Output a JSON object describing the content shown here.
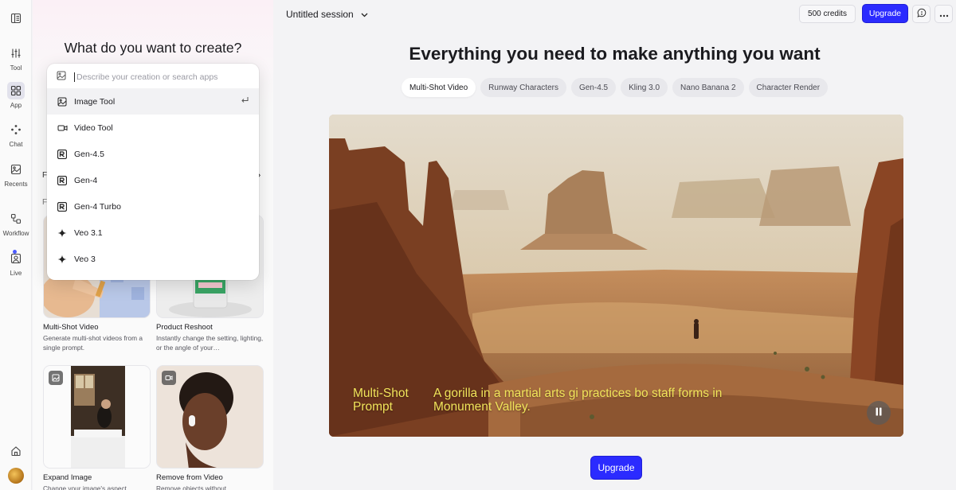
{
  "rail": {
    "items": [
      {
        "label": "",
        "icon": "sidebar-toggle-icon"
      },
      {
        "label": "Tool",
        "icon": "sliders-icon"
      },
      {
        "label": "App",
        "icon": "grid-icon",
        "active": true
      },
      {
        "label": "Chat",
        "icon": "sparkle-dots-icon"
      },
      {
        "label": "Recents",
        "icon": "images-icon"
      },
      {
        "label": "Workflow",
        "icon": "workflow-icon"
      },
      {
        "label": "Live",
        "icon": "live-icon"
      }
    ],
    "home_icon": "home-icon",
    "accent_color": "#4b5bff"
  },
  "panel": {
    "title": "What do you want to create?",
    "peek_left_1": "F",
    "peek_left_2": "F",
    "peek_chevron": "›",
    "cards": [
      {
        "title": "Multi-Shot Video",
        "desc": "Generate multi-shot videos from a single prompt."
      },
      {
        "title": "Product Reshoot",
        "desc": "Instantly change the setting, lighting, or the angle of your…"
      },
      {
        "title": "Expand Image",
        "desc": "Change your image's aspect"
      },
      {
        "title": "Remove from Video",
        "desc": "Remove objects without"
      }
    ]
  },
  "dropdown": {
    "placeholder": "Describe your creation or search apps",
    "items": [
      {
        "label": "Image Tool",
        "icon": "image-icon"
      },
      {
        "label": "Video Tool",
        "icon": "video-camera-icon"
      },
      {
        "label": "Gen-4.5",
        "icon": "runway-logo-icon"
      },
      {
        "label": "Gen-4",
        "icon": "runway-logo-icon"
      },
      {
        "label": "Gen-4 Turbo",
        "icon": "runway-logo-icon"
      },
      {
        "label": "Veo 3.1",
        "icon": "sparkle-icon"
      },
      {
        "label": "Veo 3",
        "icon": "sparkle-icon"
      }
    ]
  },
  "header": {
    "session_title": "Untitled session",
    "credits": "500 credits",
    "upgrade_label": "Upgrade",
    "brand_color": "#2b2bff"
  },
  "hero": {
    "title": "Everything you need to make anything you want",
    "tabs": [
      "Multi-Shot Video",
      "Runway Characters",
      "Gen-4.5",
      "Kling 3.0",
      "Nano Banana 2",
      "Character Render"
    ],
    "active_tab": "Multi-Shot Video"
  },
  "video": {
    "caption_label": "Multi-Shot Prompt",
    "caption_text": "A gorilla in a martial arts gi practices bo staff forms in Monument Valley.",
    "caption_color": "#f1e45a"
  },
  "footer": {
    "upgrade_label": "Upgrade"
  }
}
